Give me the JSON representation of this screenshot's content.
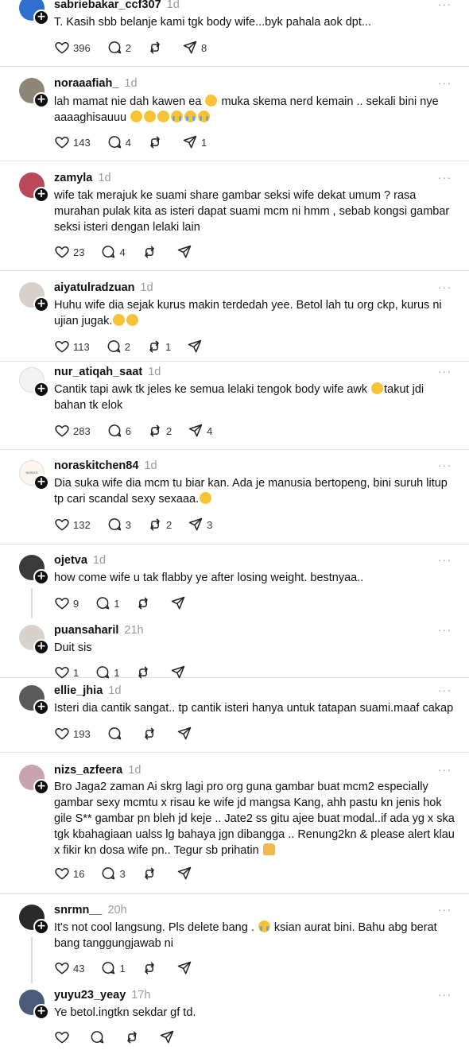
{
  "posts": [
    {
      "username": "sabriebakar_ccf307",
      "time": "1d",
      "text": "T. Kasih sbb belanje kami tgk body wife...byk pahala aok dpt...",
      "likes": "396",
      "replies": "2",
      "reposts": "",
      "shares": "8",
      "avatar_color": "#2f6fd0"
    },
    {
      "username": "noraaafiah_",
      "time": "1d",
      "text": "lah mamat nie dah kawen ea ",
      "text_b": " muka skema nerd kemain .. sekali bini nye aaaaghisauuu ",
      "likes": "143",
      "replies": "4",
      "reposts": "",
      "shares": "1",
      "avatar_color": "#8f8577"
    },
    {
      "username": "zamyla",
      "time": "1d",
      "text": "wife tak merajuk ke suami share gambar seksi wife dekat umum ? rasa murahan pulak kita as isteri dapat suami mcm ni hmm , sebab kongsi gambar seksi isteri dengan lelaki lain",
      "likes": "23",
      "replies": "4",
      "reposts": "",
      "shares": "",
      "avatar_color": "#b84a5a"
    },
    {
      "username": "aiyatulradzuan",
      "time": "1d",
      "text": "Huhu wife dia sejak kurus makin terdedah yee. Betol lah tu org ckp, kurus ni ujian jugak.",
      "likes": "113",
      "replies": "2",
      "reposts": "1",
      "shares": "",
      "avatar_color": "#d8d0c6"
    },
    {
      "username": "nur_atiqah_saat",
      "time": "1d",
      "text": "Cantik tapi awk tk jeles ke semua lelaki tengok body wife awk ",
      "text_b": "takut jdi bahan tk elok",
      "likes": "283",
      "replies": "6",
      "reposts": "2",
      "shares": "4",
      "avatar_color": "#f3f3f3"
    },
    {
      "username": "noraskitchen84",
      "time": "1d",
      "text": "Dia suka wife dia mcm tu biar kan. Ada je manusia bertopeng, bini suruh litup tp cari scandal sexy sexaaa.",
      "likes": "132",
      "replies": "3",
      "reposts": "2",
      "shares": "3",
      "avatar_color": "#faf6ee",
      "avatar_text": "NORA'S KITCHEN"
    },
    {
      "username": "ojetva",
      "time": "1d",
      "text": "how come wife u tak flabby ye after losing weight. bestnyaa..",
      "likes": "9",
      "replies": "1",
      "reposts": "",
      "shares": "",
      "avatar_color": "#3b3b3b"
    },
    {
      "username": "puansaharil",
      "time": "21h",
      "text": "Duit sis",
      "likes": "1",
      "replies": "1",
      "reposts": "",
      "shares": "",
      "avatar_color": "#d9d2c8"
    },
    {
      "username": "ellie_jhia",
      "time": "1d",
      "text": "Isteri dia cantik sangat.. tp cantik isteri hanya untuk tatapan suami.maaf cakap",
      "likes": "193",
      "replies": "",
      "reposts": "",
      "shares": "",
      "avatar_color": "#5a5a5a"
    },
    {
      "username": "nizs_azfeera",
      "time": "1d",
      "text": "Bro Jaga2 zaman Ai skrg lagi pro org guna gambar buat mcm2 especially gambar sexy mcmtu x risau ke wife jd mangsa Kang, ahh pastu kn jenis hok gile S** gambar pn bleh jd keje .. Jate2 ss gitu ajee buat modal..if ada yg x ska tgk kbahagiaan ualss lg bahaya jgn dibangga .. Renung2kn & please alert klau x fikir kn dosa wife pn.. Tegur sb prihatin ",
      "likes": "16",
      "replies": "3",
      "reposts": "",
      "shares": "",
      "avatar_color": "#c9a3b0"
    },
    {
      "username": "snrmn__",
      "time": "20h",
      "text": "It's not cool langsung. Pls delete bang . ",
      "text_b": " ksian aurat bini. Bahu abg berat bang tanggungjawab ni",
      "likes": "43",
      "replies": "1",
      "reposts": "",
      "shares": "",
      "avatar_color": "#2a2a2a"
    },
    {
      "username": "yuyu23_yeay",
      "time": "17h",
      "text": "Ye betol.ingtkn sekdar gf td.",
      "likes": "",
      "replies": "",
      "reposts": "",
      "shares": "",
      "avatar_color": "#4a5b7a"
    }
  ],
  "more_label": "···",
  "follow_glyph": "+"
}
